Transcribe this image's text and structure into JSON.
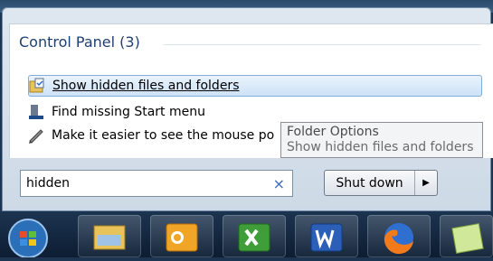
{
  "group_header": "Control Panel (3)",
  "results": [
    {
      "label": "Show hidden files and folders",
      "icon": "folder-options-icon"
    },
    {
      "label": "Find missing Start menu",
      "icon": "taskbar-icon"
    },
    {
      "label": "Make it easier to see the mouse po",
      "icon": "mouse-pointer-icon"
    }
  ],
  "tooltip": {
    "title": "Folder Options",
    "description": "Show hidden files and folders"
  },
  "search": {
    "value": "hidden",
    "clear_glyph": "×"
  },
  "shutdown": {
    "label": "Shut down",
    "arrow": "▶"
  },
  "taskbar": {
    "items": [
      "start-orb",
      "windows-explorer-icon",
      "outlook-icon",
      "excel-icon",
      "word-icon",
      "firefox-icon",
      "notes-icon"
    ]
  }
}
